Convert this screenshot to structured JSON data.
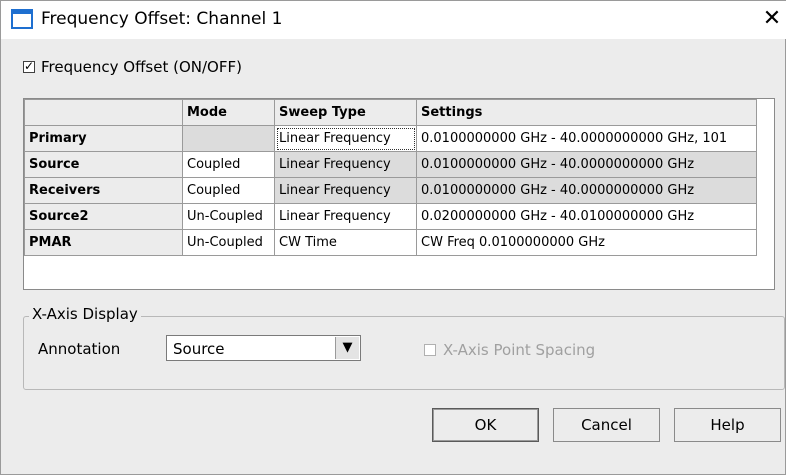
{
  "window": {
    "title": "Frequency Offset: Channel 1",
    "close_glyph": "✕"
  },
  "enable": {
    "label": "Frequency Offset (ON/OFF)",
    "checked": true,
    "check_glyph": "✓"
  },
  "table": {
    "headers": [
      "",
      "Mode",
      "Sweep Type",
      "Settings"
    ],
    "rows": [
      {
        "name": "Primary",
        "mode": "",
        "sweep": "Linear Frequency",
        "settings": "0.0100000000 GHz - 40.0000000000 GHz, 101"
      },
      {
        "name": "Source",
        "mode": "Coupled",
        "sweep": "Linear Frequency",
        "settings": "0.0100000000 GHz - 40.0000000000 GHz"
      },
      {
        "name": "Receivers",
        "mode": "Coupled",
        "sweep": "Linear Frequency",
        "settings": "0.0100000000 GHz - 40.0000000000 GHz"
      },
      {
        "name": "Source2",
        "mode": "Un-Coupled",
        "sweep": "Linear Frequency",
        "settings": "0.0200000000 GHz - 40.0100000000 GHz"
      },
      {
        "name": "PMAR",
        "mode": "Un-Coupled",
        "sweep": "CW Time",
        "settings": "CW Freq 0.0100000000 GHz"
      }
    ]
  },
  "xaxis": {
    "group_label": "X-Axis Display",
    "annotation_label": "Annotation",
    "annotation_value": "Source",
    "dropdown_glyph": "▼",
    "point_spacing_label": "X-Axis Point Spacing",
    "point_spacing_checked": false,
    "point_spacing_enabled": false
  },
  "buttons": {
    "ok": "OK",
    "cancel": "Cancel",
    "help": "Help"
  }
}
